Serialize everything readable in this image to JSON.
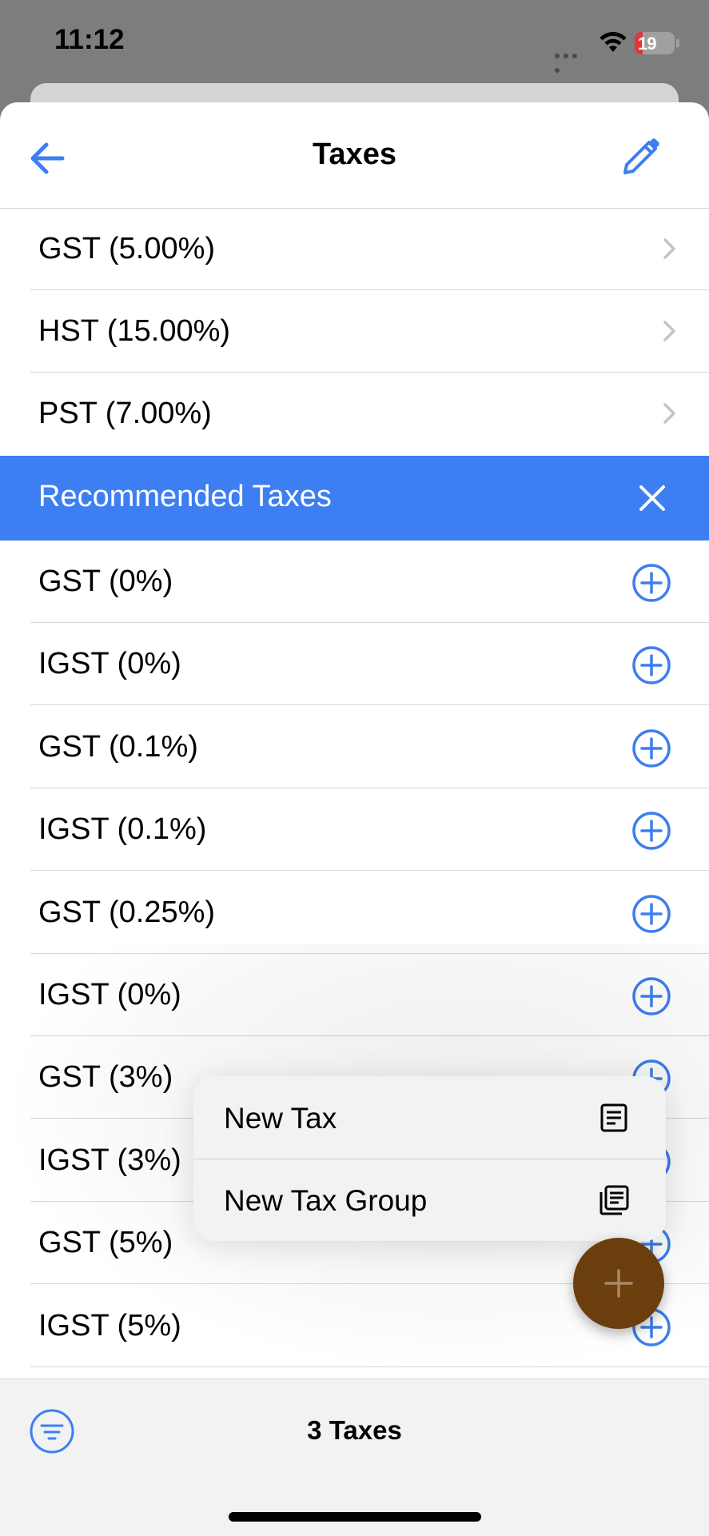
{
  "status_bar": {
    "time": "11:12",
    "battery_level": "19",
    "battery_fraction": 0.19
  },
  "nav": {
    "title": "Taxes",
    "back_icon": "arrow-left-icon",
    "edit_icon": "pencil-icon"
  },
  "taxes": [
    {
      "label": "GST (5.00%)"
    },
    {
      "label": "HST (15.00%)"
    },
    {
      "label": "PST (7.00%)"
    }
  ],
  "recommended": {
    "title": "Recommended Taxes",
    "close_icon": "close-icon",
    "items": [
      {
        "label": "GST (0%)"
      },
      {
        "label": "IGST (0%)"
      },
      {
        "label": "GST (0.1%)"
      },
      {
        "label": "IGST (0.1%)"
      },
      {
        "label": "GST (0.25%)"
      },
      {
        "label": "IGST (0%)"
      },
      {
        "label": "GST (3%)"
      },
      {
        "label": "IGST (3%)"
      },
      {
        "label": "GST (5%)"
      },
      {
        "label": "IGST (5%)"
      }
    ]
  },
  "popup_menu": {
    "items": [
      {
        "label": "New Tax",
        "icon": "document-icon"
      },
      {
        "label": "New Tax Group",
        "icon": "documents-stack-icon"
      }
    ]
  },
  "fab": {
    "icon": "plus-icon"
  },
  "bottom_bar": {
    "count": "3 Taxes",
    "filter_icon": "filter-icon"
  },
  "colors": {
    "accent": "#3d7ef2",
    "fab": "#6b3e0e",
    "header_bg": "#3d7ef2"
  }
}
